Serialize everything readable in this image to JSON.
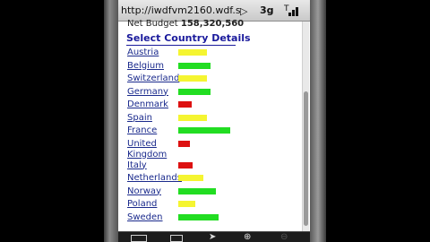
{
  "browser": {
    "url": "http://iwdfvm2160.wdf.s",
    "network": "3g"
  },
  "page": {
    "budget_label": "Net Budget",
    "budget_value": "158,320,560",
    "heading": "Select Country Details"
  },
  "colors": {
    "green": "#22dd22",
    "yellow": "#f5f531",
    "red": "#dd1111"
  },
  "countries": [
    {
      "name": "Austria",
      "status": "yellow",
      "level": 0.55
    },
    {
      "name": "Belgium",
      "status": "green",
      "level": 0.62
    },
    {
      "name": "Switzerland",
      "status": "yellow",
      "level": 0.55
    },
    {
      "name": "Germany",
      "status": "green",
      "level": 0.62
    },
    {
      "name": "Denmark",
      "status": "red",
      "level": 0.25
    },
    {
      "name": "Spain",
      "status": "yellow",
      "level": 0.55
    },
    {
      "name": "France",
      "status": "green",
      "level": 1.0
    },
    {
      "name": "United Kingdom",
      "status": "red",
      "level": 0.22
    },
    {
      "name": "Italy",
      "status": "red",
      "level": 0.28
    },
    {
      "name": "Netherlands",
      "status": "yellow",
      "level": 0.48
    },
    {
      "name": "Norway",
      "status": "green",
      "level": 0.72
    },
    {
      "name": "Poland",
      "status": "yellow",
      "level": 0.32
    },
    {
      "name": "Sweden",
      "status": "green",
      "level": 0.78
    }
  ]
}
